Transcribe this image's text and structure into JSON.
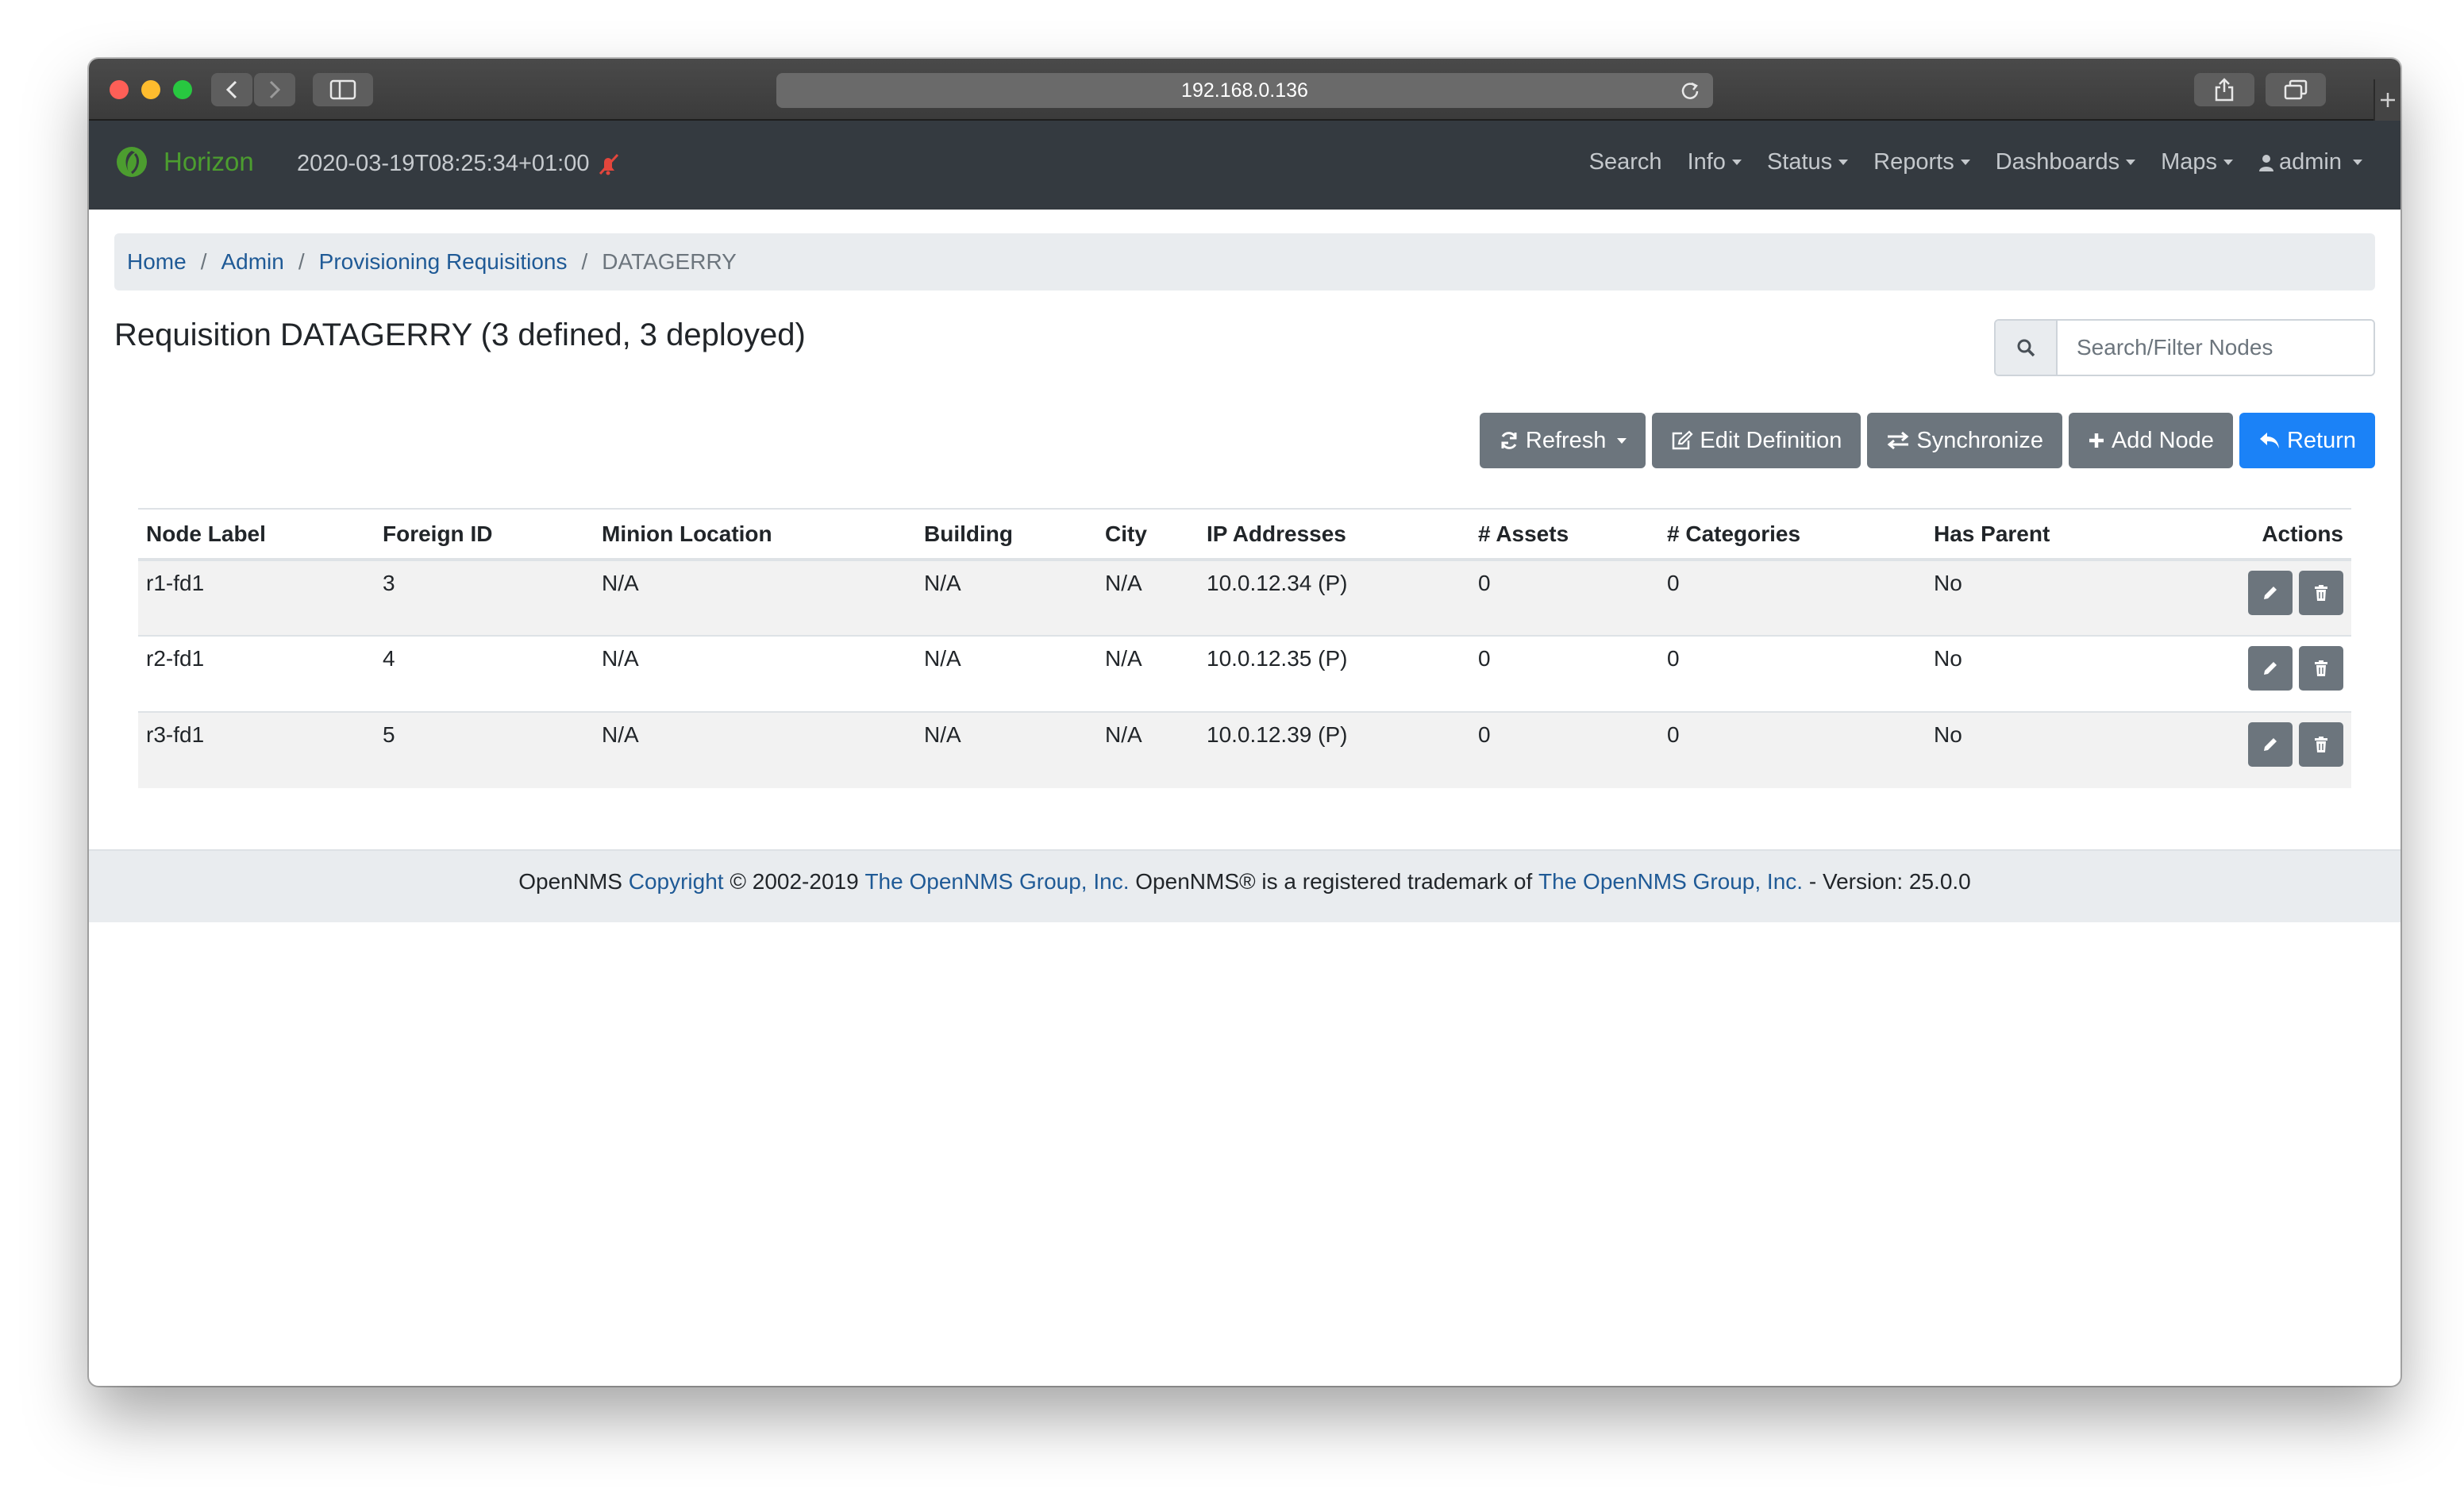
{
  "browser": {
    "url": "192.168.0.136"
  },
  "navbar": {
    "brand": "Horizon",
    "datetime": "2020-03-19T08:25:34+01:00",
    "links": [
      {
        "label": "Search",
        "dropdown": false
      },
      {
        "label": "Info",
        "dropdown": true
      },
      {
        "label": "Status",
        "dropdown": true
      },
      {
        "label": "Reports",
        "dropdown": true
      },
      {
        "label": "Dashboards",
        "dropdown": true
      },
      {
        "label": "Maps",
        "dropdown": true
      },
      {
        "label": "admin",
        "dropdown": true
      }
    ]
  },
  "breadcrumb": {
    "home": "Home",
    "admin": "Admin",
    "requisitions": "Provisioning Requisitions",
    "current": "DATAGERRY"
  },
  "page": {
    "title": "Requisition DATAGERRY (3 defined, 3 deployed)",
    "search_placeholder": "Search/Filter Nodes"
  },
  "toolbar": {
    "refresh": "Refresh",
    "edit_definition": "Edit Definition",
    "synchronize": "Synchronize",
    "add_node": "Add Node",
    "return": "Return"
  },
  "table": {
    "headers": [
      "Node Label",
      "Foreign ID",
      "Minion Location",
      "Building",
      "City",
      "IP Addresses",
      "# Assets",
      "# Categories",
      "Has Parent",
      "Actions"
    ],
    "rows": [
      [
        "r1-fd1",
        "3",
        "N/A",
        "N/A",
        "N/A",
        "10.0.12.34 (P)",
        "0",
        "0",
        "No"
      ],
      [
        "r2-fd1",
        "4",
        "N/A",
        "N/A",
        "N/A",
        "10.0.12.35 (P)",
        "0",
        "0",
        "No"
      ],
      [
        "r3-fd1",
        "5",
        "N/A",
        "N/A",
        "N/A",
        "10.0.12.39 (P)",
        "0",
        "0",
        "No"
      ]
    ]
  },
  "footer": {
    "prefix": "OpenNMS",
    "copyright_link": "Copyright",
    "years": "© 2002-2019",
    "group_link": "The OpenNMS Group, Inc.",
    "trademark": "OpenNMS® is a registered trademark of",
    "group_link2": "The OpenNMS Group, Inc.",
    "version": "- Version: 25.0.0"
  },
  "colors": {
    "navbar": "#343a40",
    "brand": "#4c9d2f",
    "link": "#1f5a96",
    "primary": "#1b82f7",
    "secondary": "#6c757d"
  }
}
